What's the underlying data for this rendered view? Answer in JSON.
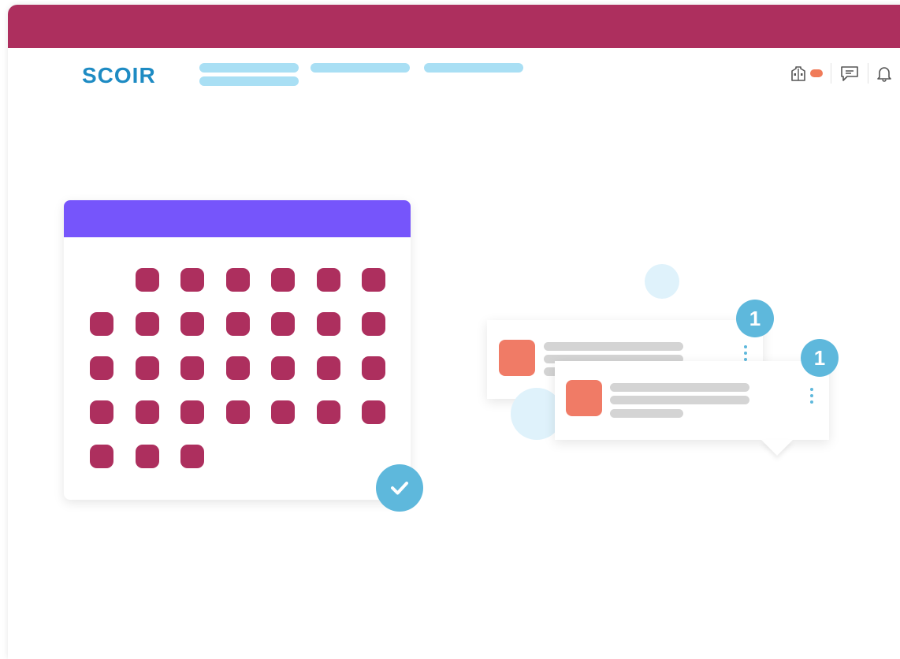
{
  "header": {
    "logo": "SCOIR",
    "nav_items": [
      "",
      "",
      ""
    ],
    "icons": [
      "school-icon",
      "chat-icon",
      "bell-icon"
    ]
  },
  "calendar": {
    "days_shown": 30
  },
  "notifications": [
    {
      "count": "1"
    },
    {
      "count": "1"
    }
  ],
  "colors": {
    "brand": "#ad2f5e",
    "logo": "#1e8bc3",
    "calendar_header": "#7655fb",
    "accent": "#5eb8dc",
    "badge": "#f07b59",
    "nav_placeholder": "#a9dff4"
  }
}
